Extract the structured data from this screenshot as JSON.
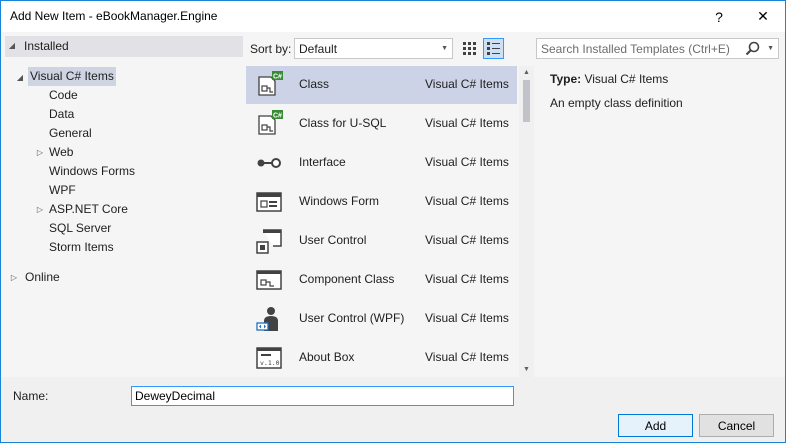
{
  "window": {
    "title": "Add New Item - eBookManager.Engine",
    "help": "?",
    "close": "✕"
  },
  "tree": {
    "installed": "Installed",
    "root": "Visual C# Items",
    "children": [
      "Code",
      "Data",
      "General",
      "Web",
      "Windows Forms",
      "WPF",
      "ASP.NET Core",
      "SQL Server",
      "Storm Items"
    ],
    "online": "Online"
  },
  "toolbar": {
    "sort_label": "Sort by:",
    "sort_value": "Default"
  },
  "search": {
    "placeholder": "Search Installed Templates (Ctrl+E)"
  },
  "templates": [
    {
      "name": "Class",
      "category": "Visual C# Items",
      "icon": "class-icon",
      "selected": true
    },
    {
      "name": "Class for U-SQL",
      "category": "Visual C# Items",
      "icon": "class-usql-icon"
    },
    {
      "name": "Interface",
      "category": "Visual C# Items",
      "icon": "interface-icon"
    },
    {
      "name": "Windows Form",
      "category": "Visual C# Items",
      "icon": "windows-form-icon"
    },
    {
      "name": "User Control",
      "category": "Visual C# Items",
      "icon": "user-control-icon"
    },
    {
      "name": "Component Class",
      "category": "Visual C# Items",
      "icon": "component-class-icon"
    },
    {
      "name": "User Control (WPF)",
      "category": "Visual C# Items",
      "icon": "user-control-wpf-icon"
    },
    {
      "name": "About Box",
      "category": "Visual C# Items",
      "icon": "about-box-icon"
    }
  ],
  "details": {
    "type_label": "Type:",
    "type_value": "Visual C# Items",
    "description": "An empty class definition"
  },
  "form": {
    "name_label": "Name:",
    "name_value": "DeweyDecimal"
  },
  "buttons": {
    "add": "Add",
    "cancel": "Cancel"
  },
  "colors": {
    "accent": "#3399ff",
    "selection": "#cdd3e6",
    "panel": "#f5f5f5"
  }
}
